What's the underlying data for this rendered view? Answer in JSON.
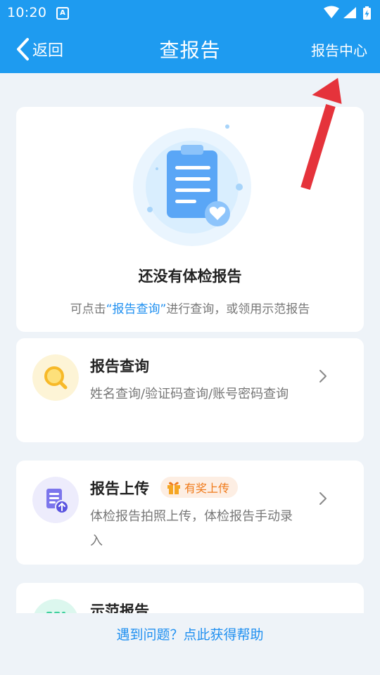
{
  "status_bar": {
    "time": "10:20",
    "app_icon_letter": "A"
  },
  "header": {
    "back_label": "返回",
    "title": "查报告",
    "right_action": "报告中心",
    "background_color": "#1e9bf0"
  },
  "empty_state": {
    "title": "还没有体检报告",
    "hint_prefix": "可点击",
    "hint_link": "“报告查询”",
    "hint_suffix": "进行查询，或领用示范报告"
  },
  "options": [
    {
      "title": "报告查询",
      "desc": "姓名查询/验证码查询/账号密码查询",
      "icon": "magnifier-icon"
    },
    {
      "title": "报告上传",
      "badge": "有奖上传",
      "desc": "体检报告拍照上传，体检报告手动录入",
      "icon": "upload-document-icon"
    },
    {
      "title": "示范报告",
      "icon": "sample-report-icon"
    }
  ],
  "footer": {
    "help_link": "遇到问题？点此获得帮助"
  },
  "colors": {
    "accent": "#1e9bf0",
    "link": "#1e8ff0",
    "badge_text": "#f07a1a",
    "annotation": "#e5333b"
  }
}
